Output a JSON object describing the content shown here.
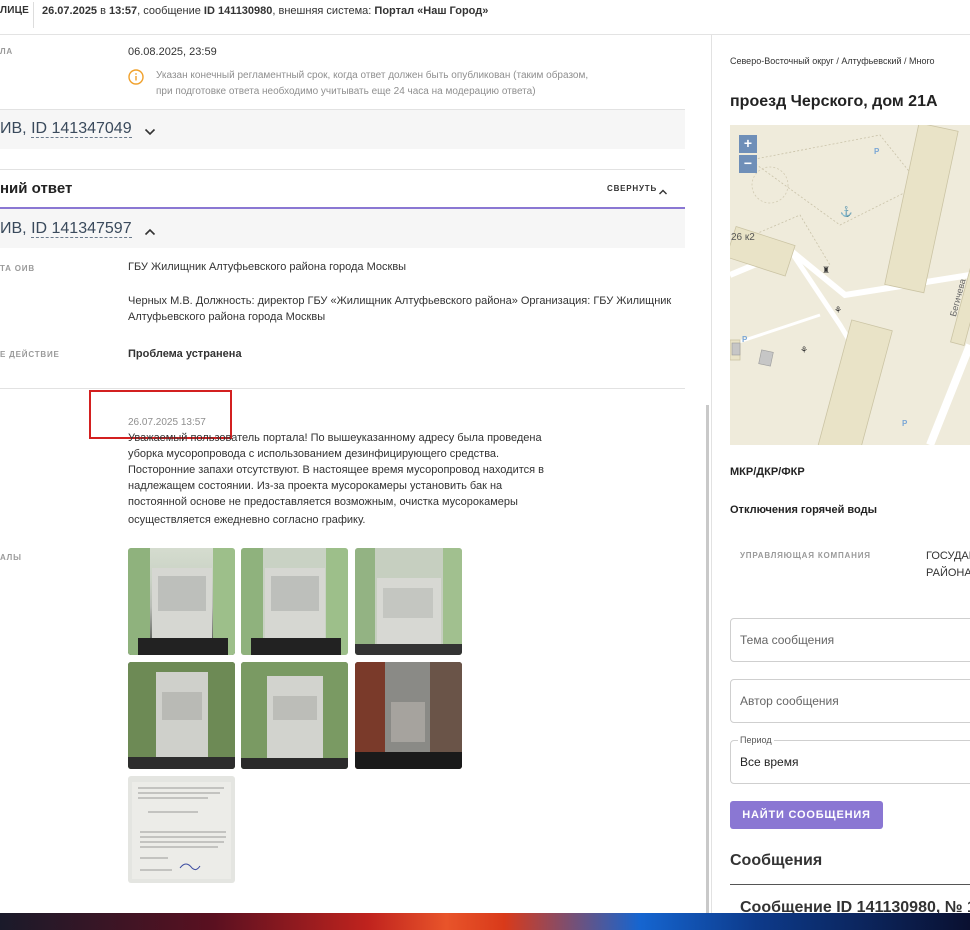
{
  "topbar": {
    "crumb": "ЛИЦЕ",
    "datetime": "26.07.2025",
    "in": " в ",
    "time": "13:57",
    "msg_prefix": ", сообщение ",
    "msg_id": "ID 141130980",
    "ext_prefix": ", внешняя система: ",
    "ext_system": "Портал «Наш Город»"
  },
  "deadline": {
    "label": "ЛА",
    "value": "06.08.2025, 23:59",
    "hint_line1": "Указан конечный регламентный срок, когда ответ должен быть опубликован (таким образом,",
    "hint_line2": "при подготовке ответа необходимо учитывать еще 24 часа на модерацию ответа)"
  },
  "oiv_block_1": {
    "prefix": "ИВ, ",
    "id": "ID 141347049"
  },
  "answer_section": {
    "title": "ний ответ",
    "collapse_label": "СВЕРНУТЬ"
  },
  "oiv_block_2": {
    "prefix": "ИВ, ",
    "id": "ID 141347597"
  },
  "details": {
    "org_label": "ТА ОИВ",
    "org_value": "ГБУ Жилищник Алтуфьевского района города Москвы",
    "person_line1": "Черных М.В. Должность: директор ГБУ «Жилищник Алтуфьевского района» Организация: ГБУ Жилищник",
    "person_line2": "Алтуфьевского района города Москвы",
    "action_label": "Е ДЕЙСТВИЕ",
    "action_value": "Проблема устранена"
  },
  "reply": {
    "timestamp": "26.07.2025 13:57",
    "lines": [
      "Уважаемый пользователь портала! По вышеуказанному адресу была проведена",
      "уборка мусоропровода с использованием дезинфицирующего средства.",
      "Посторонние запахи отсутствуют. В настоящее время мусоропровод находится в",
      "надлежащем состоянии. Из-за проекта мусорокамеры установить бак на",
      "постоянной основе не предоставляется возможным, очистка мусорокамеры",
      "осуществляется ежедневно согласно графику."
    ],
    "materials_label": "АЛЫ"
  },
  "right": {
    "breadcrumb": "Северо-Восточный округ / Алтуфьевский / Много",
    "address": "проезд Черского, дом 21А",
    "map": {
      "zoom_in": "+",
      "zoom_out": "−",
      "label_house": "26 к2",
      "label_street": "Бегичева",
      "parking": "P"
    },
    "mkr": "МКР/ДКР/ФКР",
    "hot_water": "Отключения горячей воды",
    "uk_label": "УПРАВЛЯЮЩАЯ КОМПАНИЯ",
    "uk_value_1": "ГОСУДАР",
    "uk_value_2": "РАЙОНА",
    "topic_placeholder": "Тема сообщения",
    "author_placeholder": "Автор сообщения",
    "period_label": "Период",
    "period_value": "Все время",
    "find_button": "НАЙТИ СООБЩЕНИЯ",
    "messages_title": "Сообщения",
    "message_item": "Сообщение ID 141130980, № 1"
  },
  "colors": {
    "accent": "#8a77d3",
    "highlight": "#d32020",
    "hint_icon": "#f0a02a"
  }
}
